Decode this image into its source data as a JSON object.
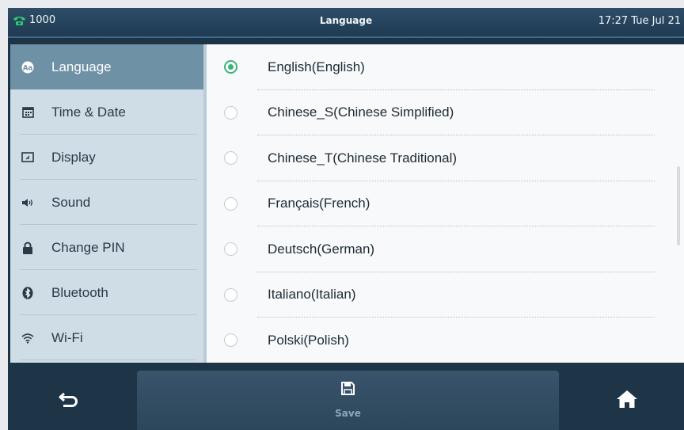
{
  "header": {
    "extension": "1000",
    "title": "Language",
    "datetime": "17:27 Tue Jul 21",
    "phone_icon_color": "#2ecc71"
  },
  "sidebar": {
    "items": [
      {
        "label": "Language",
        "icon": "language-icon",
        "active": true
      },
      {
        "label": "Time & Date",
        "icon": "calendar-icon",
        "active": false
      },
      {
        "label": "Display",
        "icon": "display-icon",
        "active": false
      },
      {
        "label": "Sound",
        "icon": "speaker-icon",
        "active": false
      },
      {
        "label": "Change PIN",
        "icon": "lock-icon",
        "active": false
      },
      {
        "label": "Bluetooth",
        "icon": "bluetooth-icon",
        "active": false
      },
      {
        "label": "Wi-Fi",
        "icon": "wifi-icon",
        "active": false
      }
    ]
  },
  "languages": {
    "selected_index": 0,
    "options": [
      "English(English)",
      "Chinese_S(Chinese Simplified)",
      "Chinese_T(Chinese Traditional)",
      "Français(French)",
      "Deutsch(German)",
      "Italiano(Italian)",
      "Polski(Polish)"
    ]
  },
  "footer": {
    "save_label": "Save",
    "back_icon": "back-icon",
    "save_icon": "floppy-disk-icon",
    "home_icon": "home-icon"
  },
  "colors": {
    "accent_green": "#3bb47a",
    "active_sidebar": "#6f91a6",
    "sidebar_bg": "#cedde6"
  }
}
